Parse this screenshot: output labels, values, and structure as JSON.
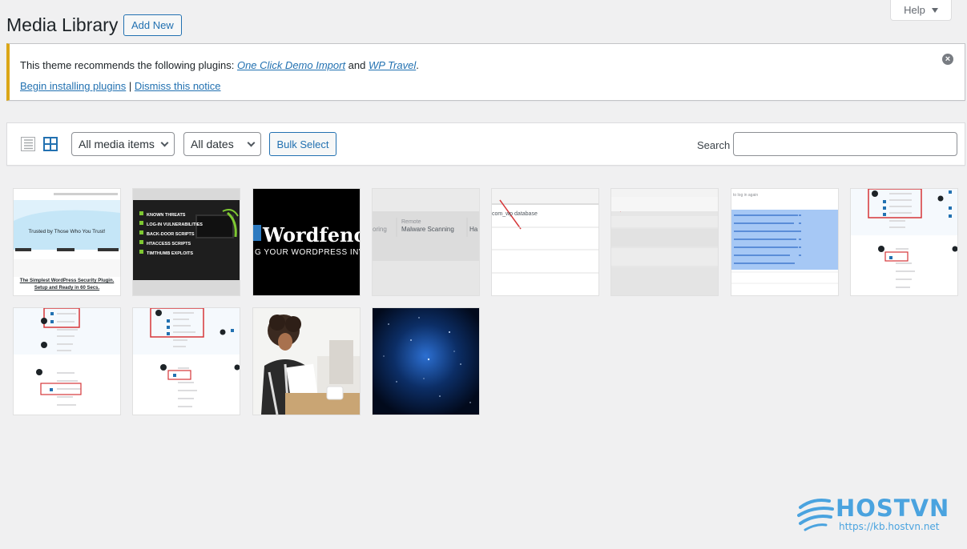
{
  "header": {
    "title": "Media Library",
    "add_new": "Add New",
    "help": "Help"
  },
  "notice": {
    "text_before": "This theme recommends the following plugins: ",
    "plugin1": "One Click Demo Import",
    "text_and": " and ",
    "plugin2": "WP Travel",
    "text_end": ".",
    "begin_installing": "Begin installing plugins",
    "separator": " | ",
    "dismiss_notice": "Dismiss this notice",
    "accent_color": "#dba617"
  },
  "toolbar": {
    "list_icon": "list-view-icon",
    "grid_icon": "grid-view-icon",
    "media_filter": "All media items",
    "date_filter": "All dates",
    "bulk_select": "Bulk Select",
    "search_label": "Search",
    "search_value": ""
  },
  "thumbnails": [
    {
      "t1": "Trusted by Those Who You Trust!",
      "t2": "The Simplest WordPress Security Plugin.",
      "t3": "Setup and Ready in 60 Secs."
    },
    {
      "l1": "KNOWN THREATS",
      "l2": "LOG-IN VULNERABILITIES",
      "l3": "BACK-DOOR SCRIPTS",
      "l4": "HTACCESS SCRIPTS",
      "l5": "TIMTHUMB EXPLOITS"
    },
    {
      "t1": "Wordfenc",
      "t2": "G YOUR WORDPRESS INVE"
    },
    {
      "t1": "Remote",
      "t2": "Malware Scanning",
      "t3": "oring",
      "t4": "Ha"
    },
    {
      "t1": "com_wp",
      "t2": "database"
    },
    {},
    {
      "t1": "to log in again"
    },
    {},
    {},
    {},
    {},
    {}
  ],
  "watermark": {
    "name": "HOSTVN",
    "url": "https://kb.hostvn.net",
    "color": "#4aa3df"
  }
}
